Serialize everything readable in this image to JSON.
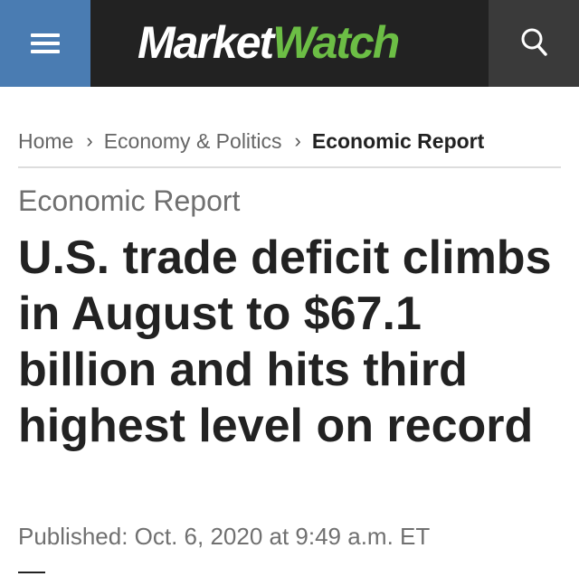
{
  "header": {
    "logo": {
      "part1": "Market",
      "part2": "Watch"
    },
    "menu_icon": "hamburger-menu-icon",
    "search_icon": "search-icon",
    "colors": {
      "bar": "#222222",
      "menu_button": "#4a7cb2",
      "search_button": "#3a3a3a",
      "logo_accent": "#6cbe45"
    }
  },
  "breadcrumb": {
    "items": [
      "Home",
      "Economy & Politics",
      "Economic Report"
    ],
    "separator_icon": "chevron-right-icon"
  },
  "article": {
    "section": "Economic Report",
    "headline": "U.S. trade deficit climbs in August to $67.1 billion and hits third highest level on record",
    "published": "Published: Oct. 6, 2020 at 9:49 a.m. ET"
  }
}
